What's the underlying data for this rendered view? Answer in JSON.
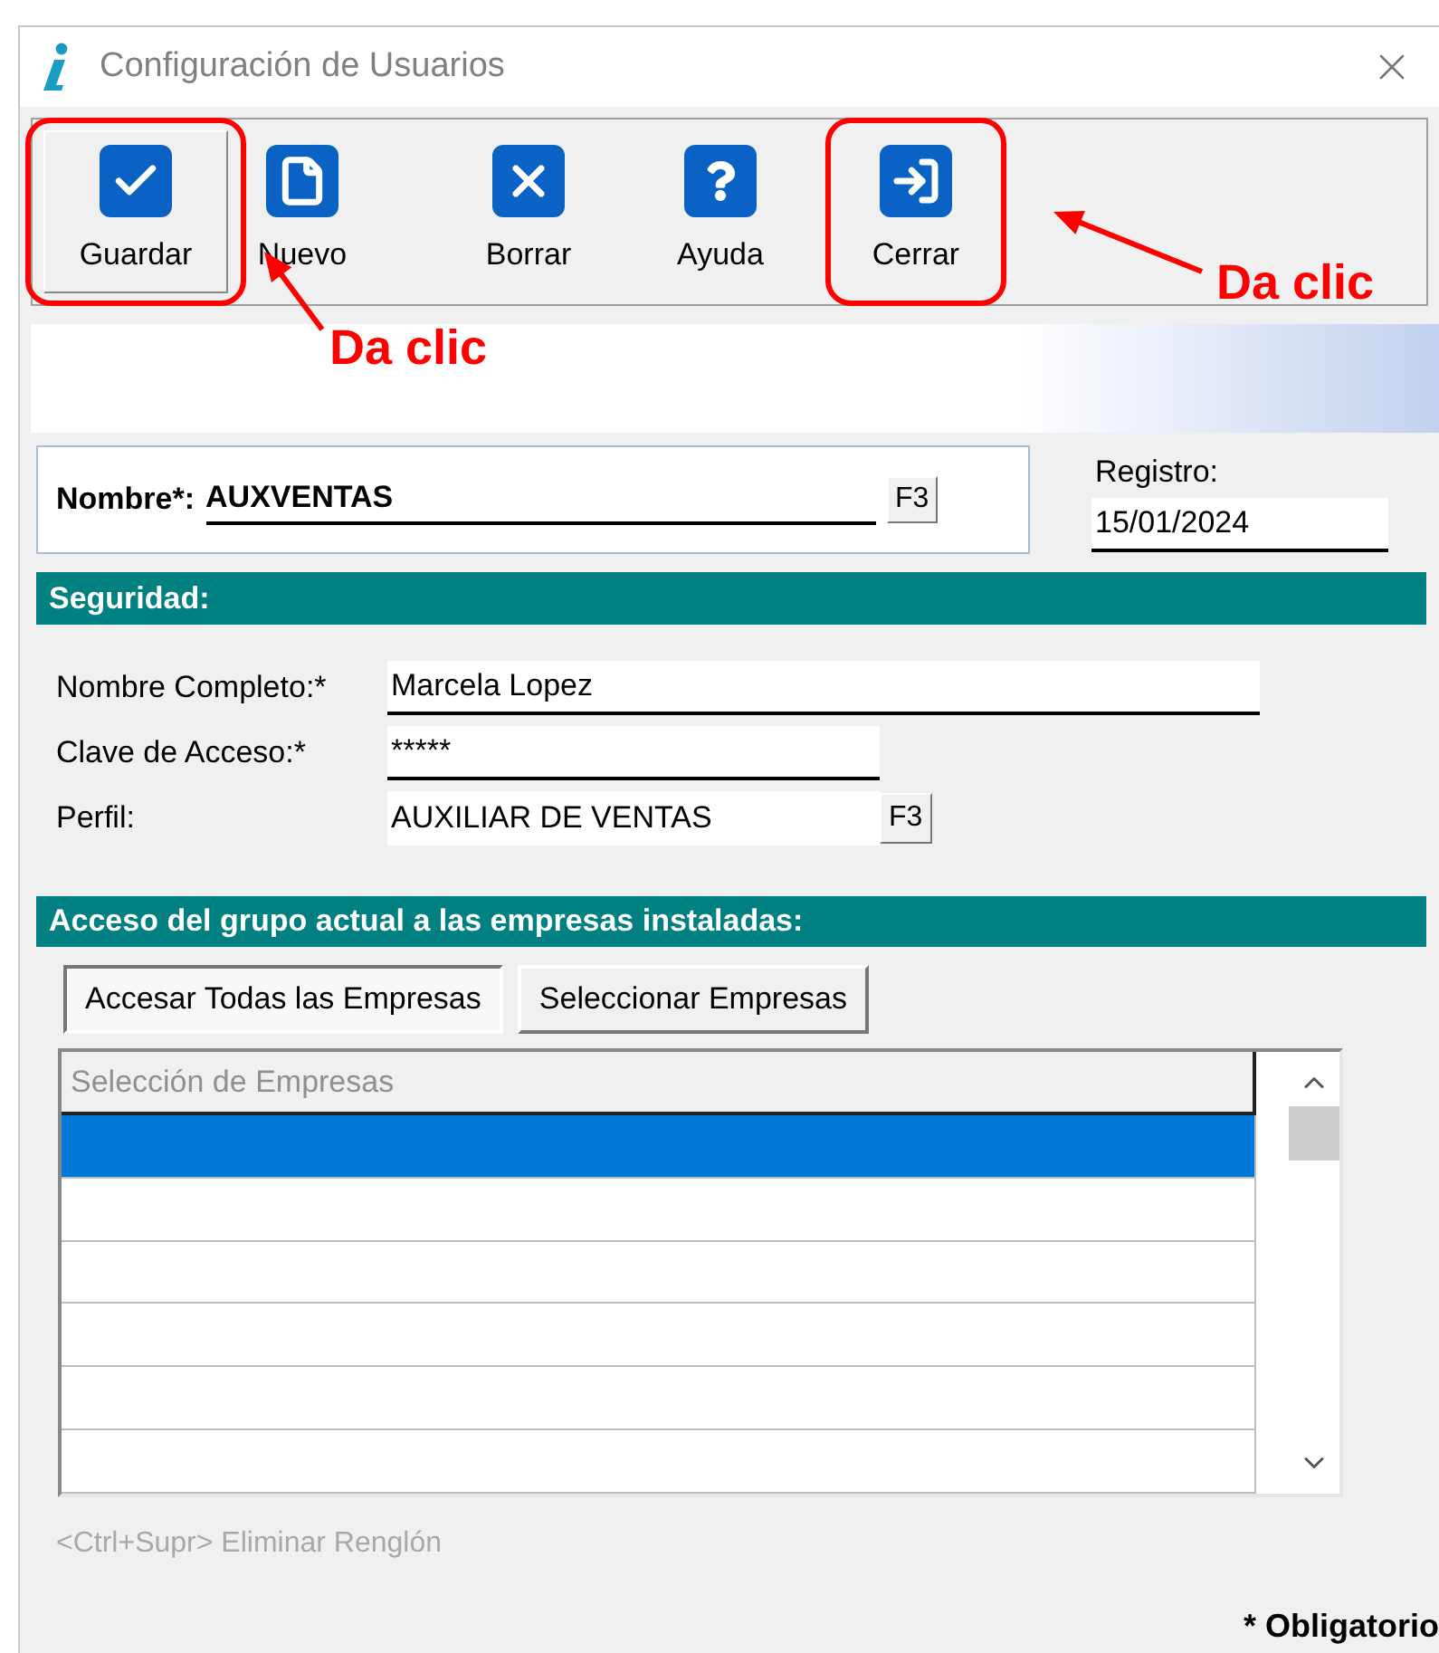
{
  "window": {
    "title": "Configuración de Usuarios"
  },
  "toolbar": {
    "buttons": [
      {
        "label": "Guardar",
        "kind": "save",
        "selected": true,
        "highlighted": true
      },
      {
        "label": "Nuevo",
        "kind": "new",
        "selected": false,
        "highlighted": false
      },
      {
        "label": "Borrar",
        "kind": "delete",
        "selected": false,
        "highlighted": false
      },
      {
        "label": "Ayuda",
        "kind": "help",
        "selected": false,
        "highlighted": false
      },
      {
        "label": "Cerrar",
        "kind": "exit",
        "selected": false,
        "highlighted": true
      }
    ]
  },
  "annotations": [
    {
      "text": "Da clic"
    },
    {
      "text": "Da clic"
    }
  ],
  "user": {
    "label": "Nombre*:",
    "value": "AUXVENTAS",
    "button": "F3"
  },
  "registro": {
    "label": "Registro:",
    "value": "15/01/2024"
  },
  "security": {
    "title": "Seguridad:",
    "fields": [
      {
        "label": "Nombre Completo:*",
        "value": "Marcela Lopez",
        "kind": "long"
      },
      {
        "label": "Clave de Acceso:*",
        "value": "*****",
        "kind": "short"
      },
      {
        "label": "Perfil:",
        "value": "AUXILIAR DE VENTAS",
        "kind": "lookup",
        "button": "F3"
      }
    ]
  },
  "access": {
    "title": "Acceso del grupo actual a las empresas instaladas:",
    "buttons": [
      {
        "label": "Accesar Todas las Empresas",
        "selected": true
      },
      {
        "label": "Seleccionar Empresas",
        "selected": false
      }
    ],
    "grid": {
      "columns": [
        "Selección de Empresas"
      ],
      "rows": [
        {
          "selected": true
        },
        {
          "selected": false
        },
        {
          "selected": false
        },
        {
          "selected": false
        },
        {
          "selected": false
        },
        {
          "selected": false
        }
      ]
    },
    "hint": "<Ctrl+Supr> Eliminar Renglón"
  },
  "footer": "* Obligatorio"
}
